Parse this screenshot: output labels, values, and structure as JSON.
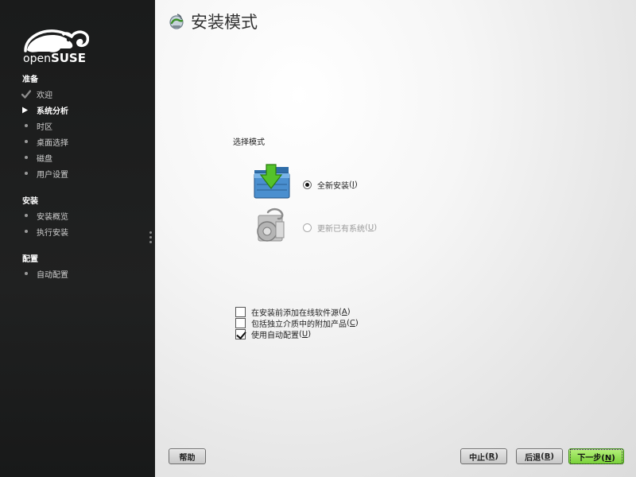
{
  "sidebar": {
    "brand": {
      "prefix": "open",
      "suffix": "SUSE"
    },
    "sections": [
      {
        "title": "准备",
        "steps": [
          {
            "label": "欢迎",
            "state": "done"
          },
          {
            "label": "系统分析",
            "state": "current"
          },
          {
            "label": "时区",
            "state": "pending"
          },
          {
            "label": "桌面选择",
            "state": "pending"
          },
          {
            "label": "磁盘",
            "state": "pending"
          },
          {
            "label": "用户设置",
            "state": "pending"
          }
        ]
      },
      {
        "title": "安装",
        "steps": [
          {
            "label": "安装概览",
            "state": "pending"
          },
          {
            "label": "执行安装",
            "state": "pending"
          }
        ]
      },
      {
        "title": "配置",
        "steps": [
          {
            "label": "自动配置",
            "state": "pending"
          }
        ]
      }
    ]
  },
  "main": {
    "title": "安装模式",
    "mode_label": "选择模式",
    "modes": [
      {
        "label": "全新安装",
        "hotkey": "I",
        "selected": true,
        "enabled": true,
        "icon": "new-install-icon"
      },
      {
        "label": "更新已有系统",
        "hotkey": "U",
        "selected": false,
        "enabled": false,
        "icon": "update-system-icon"
      }
    ],
    "options": [
      {
        "label": "在安装前添加在线软件源",
        "hotkey": "A",
        "checked": false
      },
      {
        "label": "包括独立介质中的附加产品",
        "hotkey": "C",
        "checked": false
      },
      {
        "label": "使用自动配置",
        "hotkey": "U",
        "checked": true
      }
    ]
  },
  "buttons": {
    "help": "帮助",
    "abort": "中止",
    "abort_key": "R",
    "back": "后退",
    "back_key": "B",
    "next": "下一步",
    "next_key": "N"
  },
  "colors": {
    "sidebar_bg": "#1c1d1d",
    "accent_green": "#7ad23a",
    "brand_green": "#73ba25"
  }
}
